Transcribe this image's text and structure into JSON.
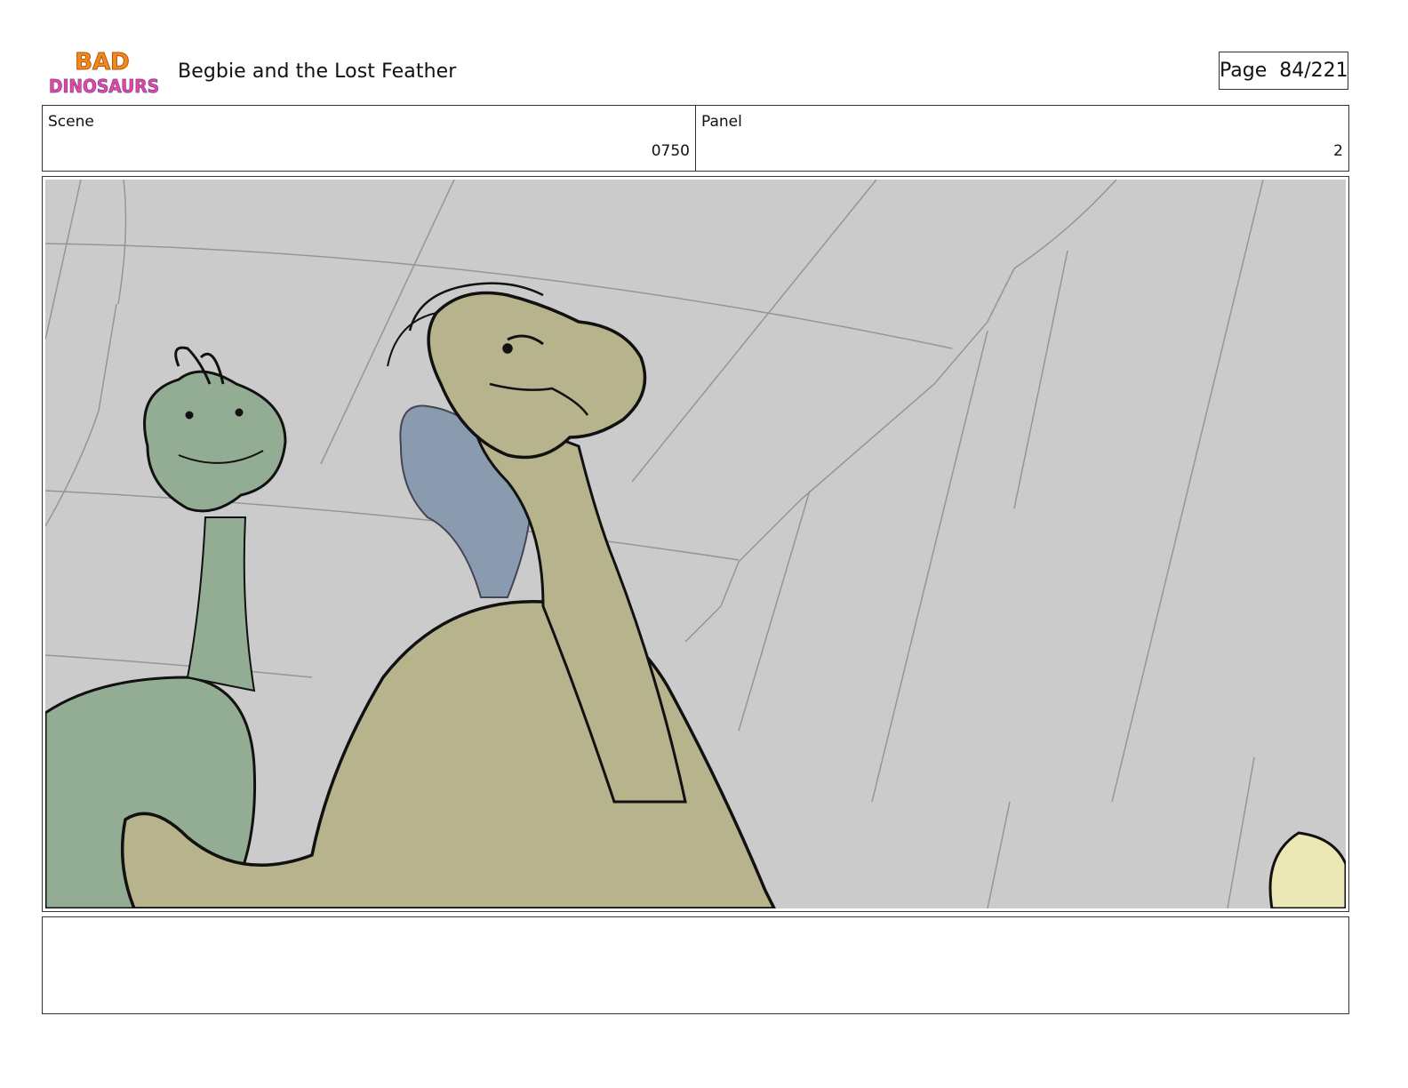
{
  "header": {
    "logo_text_line1": "BAD",
    "logo_text_line2": "DINOSAURS",
    "title": "Begbie and the Lost Feather",
    "page_label": "Page",
    "page_number": "84/221"
  },
  "info": {
    "scene_label": "Scene",
    "scene_value": "0750",
    "panel_label": "Panel",
    "panel_value": "2"
  },
  "notes": {
    "text": ""
  },
  "colors": {
    "panel_background": "#cbcbcb",
    "dino_green": "#93ad94",
    "dino_olive": "#b7b38c",
    "dino_blue": "#8a9bb0",
    "ink": "#111111"
  }
}
